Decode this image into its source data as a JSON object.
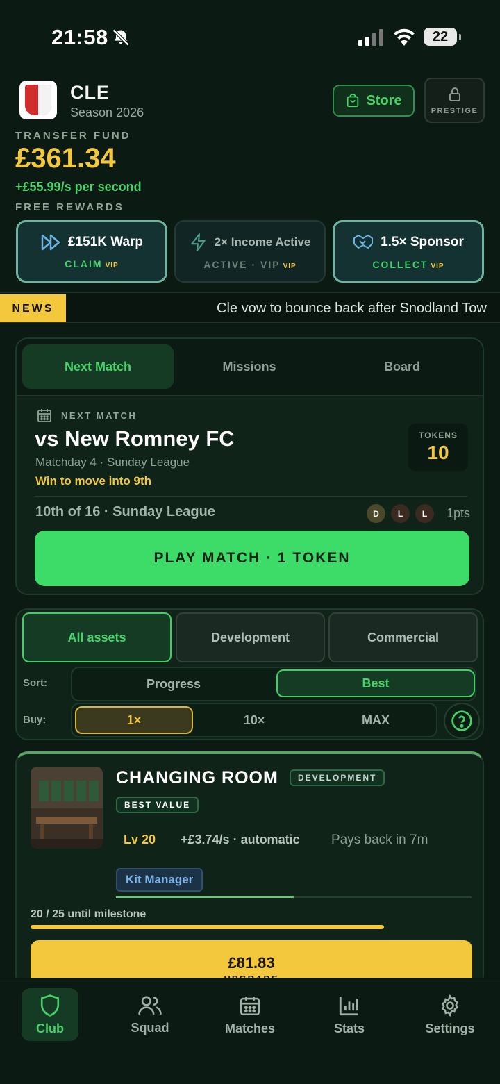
{
  "status_bar": {
    "time": "21:58",
    "battery": "22"
  },
  "club": {
    "code": "CLE",
    "season": "Season 2026"
  },
  "header": {
    "store_label": "Store",
    "prestige_label": "PRESTIGE"
  },
  "fund": {
    "label": "TRANSFER FUND",
    "value": "£361.34",
    "rate": "+£55.99/s per second"
  },
  "rewards": {
    "label": "FREE REWARDS",
    "items": [
      {
        "title": "£151K Warp",
        "action": "CLAIM",
        "vip": "VIP"
      },
      {
        "title": "2× Income Active",
        "action": "ACTIVE · VIP",
        "vip": "VIP"
      },
      {
        "title": "1.5× Sponsor",
        "action": "COLLECT",
        "vip": "VIP"
      }
    ]
  },
  "news": {
    "tag": "NEWS",
    "headline": "Cle vow to bounce back after Snodland Tow"
  },
  "match_tabs": [
    "Next Match",
    "Missions",
    "Board"
  ],
  "next_match": {
    "section_label": "NEXT MATCH",
    "opponent": "vs New Romney FC",
    "matchday": "Matchday 4 · Sunday League",
    "objective": "Win to move into 9th",
    "tokens_label": "TOKENS",
    "tokens_value": "10",
    "standing": "10th of 16 · Sunday League",
    "form": [
      "D",
      "L",
      "L"
    ],
    "points": "1pts",
    "play_label": "PLAY MATCH · 1 TOKEN"
  },
  "filters": {
    "categories": [
      "All assets",
      "Development",
      "Commercial"
    ],
    "sort_label": "Sort:",
    "sort_options": [
      "Progress",
      "Best"
    ],
    "buy_label": "Buy:",
    "buy_options": [
      "1×",
      "10×",
      "MAX"
    ]
  },
  "asset": {
    "title": "CHANGING ROOM",
    "category_tag": "DEVELOPMENT",
    "badge": "BEST VALUE",
    "level": "Lv 20",
    "income": "+£3.74/s · automatic",
    "payback": "Pays back in 7m",
    "manager": "Kit Manager",
    "manager_progress": 0.5,
    "milestone": "20 / 25 until milestone",
    "milestone_progress": 0.8,
    "upgrade_price": "£81.83",
    "upgrade_label": "UPGRADE"
  },
  "nav": [
    "Club",
    "Squad",
    "Matches",
    "Stats",
    "Settings"
  ],
  "colors": {
    "accent_green": "#45d36a",
    "gold": "#f3c83c",
    "background": "#0b1a12"
  }
}
